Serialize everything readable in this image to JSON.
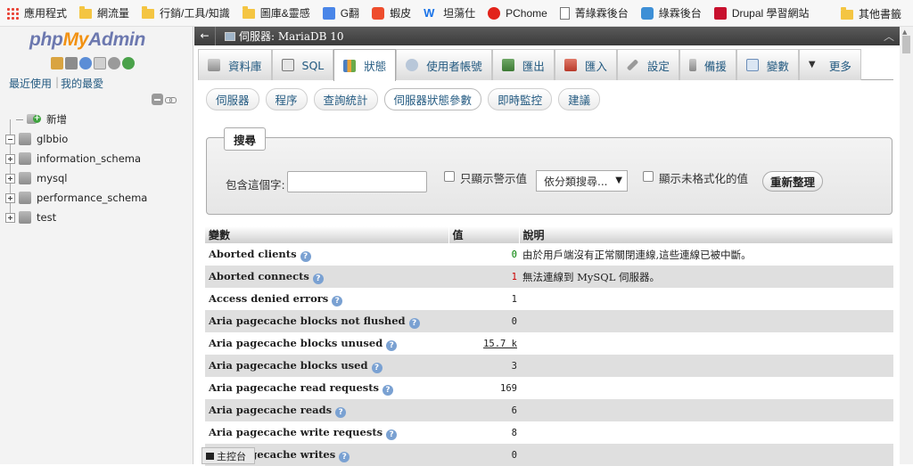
{
  "bookmarks": {
    "items": [
      {
        "label": "應用程式",
        "icon": "apps-grid-icon"
      },
      {
        "label": "網流量",
        "icon": "folder-icon"
      },
      {
        "label": "行銷/工具/知識",
        "icon": "folder-icon"
      },
      {
        "label": "圖庫&靈感",
        "icon": "folder-icon"
      },
      {
        "label": "G翻",
        "icon": "google-translate-icon"
      },
      {
        "label": "蝦皮",
        "icon": "shopee-icon"
      },
      {
        "label": "坦蕩仕",
        "icon": "w-logo-icon"
      },
      {
        "label": "PChome",
        "icon": "pchome-icon"
      },
      {
        "label": "菁綠霖後台",
        "icon": "page-icon"
      },
      {
        "label": "綠霖後台",
        "icon": "site-icon"
      },
      {
        "label": "Drupal 學習網站",
        "icon": "drupal-icon"
      }
    ],
    "other": "其他書籤"
  },
  "nav": {
    "logo": {
      "php": "php",
      "my": "My",
      "admin": "Admin"
    },
    "links": {
      "recent": "最近使用",
      "favorites": "我的最愛"
    },
    "tree": [
      {
        "label": "新增",
        "type": "new"
      },
      {
        "label": "glbbio",
        "type": "db",
        "expanded": true
      },
      {
        "label": "information_schema",
        "type": "db"
      },
      {
        "label": "mysql",
        "type": "db"
      },
      {
        "label": "performance_schema",
        "type": "db"
      },
      {
        "label": "test",
        "type": "db"
      }
    ]
  },
  "breadcrumb": {
    "server": "伺服器: MariaDB 10"
  },
  "tabs": [
    {
      "label": "資料庫",
      "icon": "database-icon"
    },
    {
      "label": "SQL",
      "icon": "sql-icon"
    },
    {
      "label": "狀態",
      "icon": "status-icon",
      "active": true
    },
    {
      "label": "使用者帳號",
      "icon": "users-icon"
    },
    {
      "label": "匯出",
      "icon": "export-icon"
    },
    {
      "label": "匯入",
      "icon": "import-icon"
    },
    {
      "label": "設定",
      "icon": "wrench-icon"
    },
    {
      "label": "備援",
      "icon": "replication-icon"
    },
    {
      "label": "變數",
      "icon": "variables-icon"
    },
    {
      "label": "更多",
      "icon": "more-icon"
    }
  ],
  "subtabs": [
    {
      "label": "伺服器"
    },
    {
      "label": "程序"
    },
    {
      "label": "查詢統計"
    },
    {
      "label": "伺服器狀態參數",
      "active": true
    },
    {
      "label": "即時監控"
    },
    {
      "label": "建議"
    }
  ],
  "search": {
    "legend": "搜尋",
    "contains_label": "包含這個字:",
    "contains_value": "",
    "only_alerts_label": "只顯示警示值",
    "filter_select": "依分類搜尋...",
    "unformatted_label": "顯示未格式化的值",
    "refresh_button": "重新整理"
  },
  "table": {
    "headers": {
      "variable": "變數",
      "value": "值",
      "description": "說明"
    },
    "rows": [
      {
        "name": "Aborted clients",
        "value": "0",
        "value_color": "#008000",
        "description": "由於用戶端沒有正常關閉連線,這些連線已被中斷。"
      },
      {
        "name": "Aborted connects",
        "value": "1",
        "value_color": "#cc0000",
        "description": "無法連線到 MySQL 伺服器。"
      },
      {
        "name": "Access denied errors",
        "value": "1",
        "description": ""
      },
      {
        "name": "Aria pagecache blocks not flushed",
        "value": "0",
        "description": ""
      },
      {
        "name": "Aria pagecache blocks unused",
        "value": "15.7 k",
        "underline": true,
        "description": ""
      },
      {
        "name": "Aria pagecache blocks used",
        "value": "3",
        "description": ""
      },
      {
        "name": "Aria pagecache read requests",
        "value": "169",
        "description": ""
      },
      {
        "name": "Aria pagecache reads",
        "value": "6",
        "description": ""
      },
      {
        "name": "Aria pagecache write requests",
        "value": "8",
        "description": ""
      },
      {
        "name": "Aria pagecache writes",
        "value": "0",
        "description": ""
      }
    ]
  },
  "console": {
    "label": "主控台"
  },
  "colors": {
    "link": "#235a81",
    "logo_blue": "#6c78af",
    "logo_orange": "#f29111",
    "row_alt": "#dfdfdf"
  }
}
